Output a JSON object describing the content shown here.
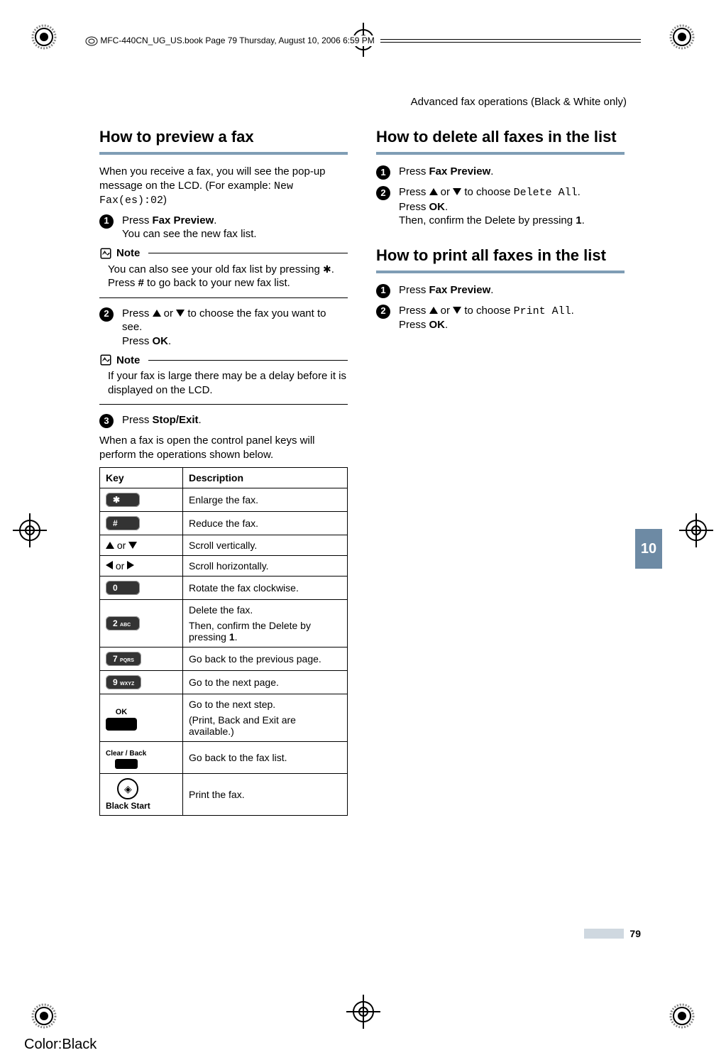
{
  "framemaker_bar": "MFC-440CN_UG_US.book  Page 79  Thursday, August 10, 2006  6:59 PM",
  "section_header": "Advanced fax operations (Black & White only)",
  "left": {
    "title": "How to preview a fax",
    "intro_a": "When you receive a fax, you will see the pop-up message on the LCD. (For example: ",
    "intro_mono": "New Fax(es):02",
    "intro_b": ")",
    "step1_a": "Press ",
    "step1_bold": "Fax Preview",
    "step1_b": ".",
    "step1_line2": "You can see the new fax list.",
    "note1_label": "Note",
    "note1_a": "You can also see your old fax list by pressing ",
    "note1_star": "✱",
    "note1_b": ". Press ",
    "note1_hash": "#",
    "note1_c": " to go back to your new fax list.",
    "step2_a": "Press ",
    "step2_or": " or ",
    "step2_b": " to choose the fax you want to see.",
    "step2_line2_a": "Press ",
    "step2_line2_bold": "OK",
    "step2_line2_b": ".",
    "note2_label": "Note",
    "note2_body": "If your fax is large there may be a delay before it is displayed on the LCD.",
    "step3_a": "Press ",
    "step3_bold": "Stop/Exit",
    "step3_b": ".",
    "below_para": "When a fax is open the control panel keys will perform the operations shown below.",
    "table": {
      "head_key": "Key",
      "head_desc": "Description",
      "rows": [
        {
          "key_type": "pad",
          "key_label": "✱",
          "desc": "Enlarge the fax."
        },
        {
          "key_type": "pad",
          "key_label": "#",
          "desc": "Reduce the fax."
        },
        {
          "key_type": "updown",
          "or": " or ",
          "desc": "Scroll vertically."
        },
        {
          "key_type": "leftright",
          "or": " or ",
          "desc": "Scroll horizontally."
        },
        {
          "key_type": "pad",
          "key_label": "0",
          "desc": "Rotate the fax clockwise."
        },
        {
          "key_type": "pad2",
          "key_label": "2",
          "key_sub": "ABC",
          "desc_a": "Delete the fax.",
          "desc_b_a": "Then, confirm the Delete by pressing ",
          "desc_b_bold": "1",
          "desc_b_b": "."
        },
        {
          "key_type": "pad2",
          "key_label": "7",
          "key_sub": "PQRS",
          "desc": "Go back to the previous page."
        },
        {
          "key_type": "pad2",
          "key_label": "9",
          "key_sub": "WXYZ",
          "desc": "Go to the next page."
        },
        {
          "key_type": "ok",
          "ok_label": "OK",
          "desc_a": "Go to the next step.",
          "desc_b": "(Print, Back and Exit are available.)"
        },
        {
          "key_type": "clearback",
          "cb_label": "Clear / Back",
          "desc": "Go back to the fax list."
        },
        {
          "key_type": "blackstart",
          "bs_label": "Black Start",
          "desc": "Print the fax."
        }
      ]
    }
  },
  "right": {
    "title1": "How to delete all faxes in the list",
    "t1_step1_a": "Press ",
    "t1_step1_bold": "Fax Preview",
    "t1_step1_b": ".",
    "t1_step2_a": "Press ",
    "t1_step2_or": " or ",
    "t1_step2_b": " to choose ",
    "t1_step2_mono": "Delete All",
    "t1_step2_c": ".",
    "t1_step2_line2_a": "Press ",
    "t1_step2_line2_bold": "OK",
    "t1_step2_line2_b": ".",
    "t1_step2_line3_a": "Then, confirm the Delete by pressing ",
    "t1_step2_line3_bold": "1",
    "t1_step2_line3_b": ".",
    "title2": "How to print all faxes in the list",
    "t2_step1_a": "Press ",
    "t2_step1_bold": "Fax Preview",
    "t2_step1_b": ".",
    "t2_step2_a": "Press ",
    "t2_step2_or": " or ",
    "t2_step2_b": " to choose ",
    "t2_step2_mono": "Print All",
    "t2_step2_c": ".",
    "t2_step2_line2_a": "Press ",
    "t2_step2_line2_bold": "OK",
    "t2_step2_line2_b": "."
  },
  "side_tab": "10",
  "page_number": "79",
  "color_label": "Color:Black"
}
